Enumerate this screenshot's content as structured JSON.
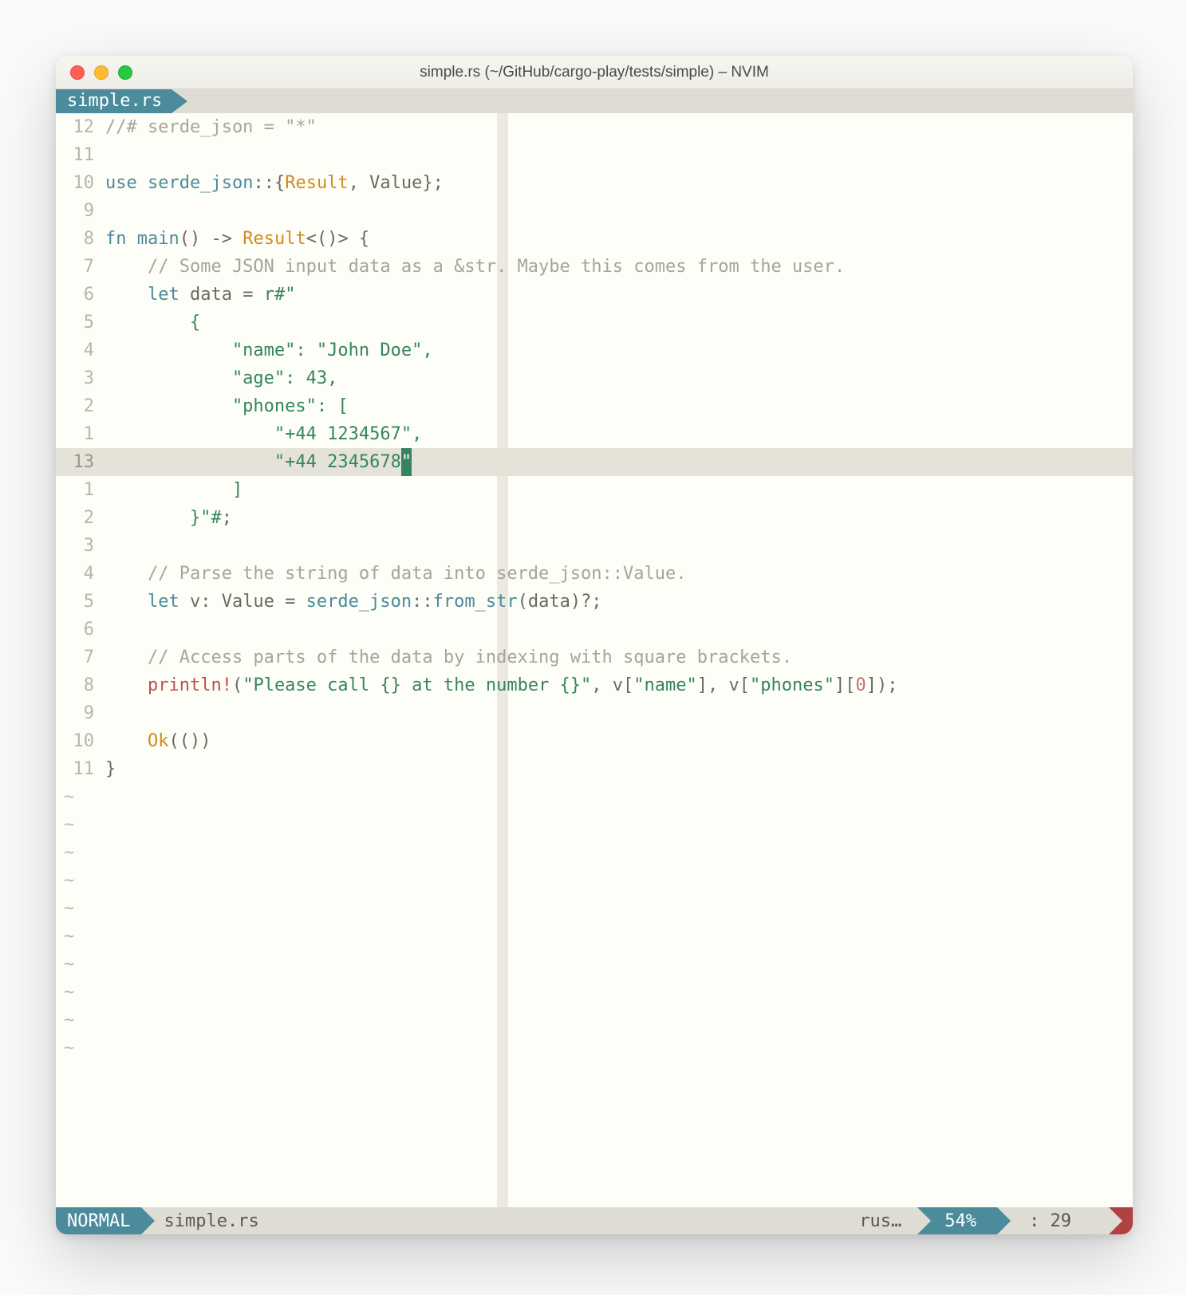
{
  "window": {
    "title": "simple.rs (~/GitHub/cargo-play/tests/simple) – NVIM"
  },
  "tab": {
    "label": "simple.rs"
  },
  "status": {
    "mode": "NORMAL",
    "file": "simple.rs",
    "lang": "rus…",
    "percent": "54%",
    "col_label": ":",
    "col": "29"
  },
  "gutters": [
    "12",
    "11",
    "10",
    "9",
    "8",
    "7",
    "6",
    "5",
    "4",
    "3",
    "2",
    "1",
    "13",
    "1",
    "2",
    "3",
    "4",
    "5",
    "6",
    "7",
    "8",
    "9",
    "10",
    "11"
  ],
  "current_index": 12,
  "tilde_count": 10,
  "tokens": {
    "l0_a": "//# serde_json = \"*\"",
    "l2_use": "use",
    "l2_ident": " serde_json",
    "l2_colon": "::{",
    "l2_res": "Result",
    "l2_mid": ", Value};",
    "l4_fn": "fn",
    "l4_main": " main",
    "l4_par": "() -> ",
    "l4_res": "Result",
    "l4_after": "<()>",
    "l4_brace": " {",
    "l5_com": "    // Some JSON input data as a &str. Maybe this comes from the user.",
    "l6_let": "    let",
    "l6_var": " data ",
    "l6_eq": "= ",
    "l6_r": "r#\"",
    "l7_s": "        {",
    "l8_s": "            \"name\": \"John Doe\",",
    "l9_a": "            \"age\"",
    "l9_b": ": ",
    "l9_num": "43",
    "l9_c": ",",
    "l10_s": "            \"phones\": [",
    "l11_s": "                \"+44 1234567\"",
    "l11_c": ",",
    "l12_s": "                \"+44 2345678",
    "l12_cur": "\"",
    "l13_s": "            ]",
    "l14_s": "        }\"#",
    "l14_semi": ";",
    "l16_com": "    // Parse the string of data into serde_json::Value.",
    "l17_let": "    let",
    "l17_v": " v: Value ",
    "l17_eq": "= ",
    "l17_sj": "serde_json",
    "l17_cc": "::",
    "l17_fn": "from_str",
    "l17_end": "(data)?;",
    "l19_com": "    // Access parts of the data by indexing with square brackets.",
    "l20_mac": "    println!",
    "l20_p1": "(",
    "l20_fmt": "\"Please call {} at the number {}\"",
    "l20_mid1": ", v[",
    "l20_k1": "\"name\"",
    "l20_mid2": "], v[",
    "l20_k2": "\"phones\"",
    "l20_mid3": "][",
    "l20_zero": "0",
    "l20_end": "]);",
    "l22_ok": "    Ok",
    "l22_par": "(())",
    "l23": "}"
  }
}
